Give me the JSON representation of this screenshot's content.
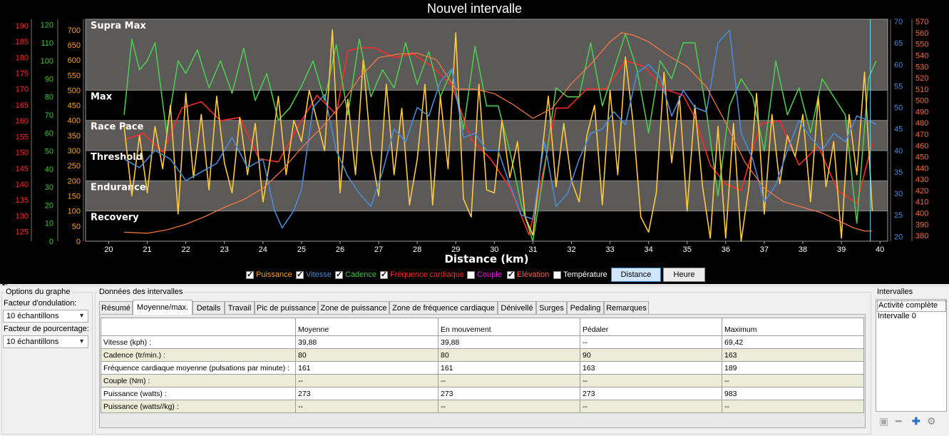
{
  "window": {
    "title": "Nouvel intervalle"
  },
  "chart_data": {
    "type": "line",
    "title": "Nouvel intervalle",
    "xlabel": "Distance (km)",
    "x_ticks": [
      20,
      21,
      22,
      23,
      24,
      25,
      26,
      27,
      28,
      29,
      30,
      31,
      32,
      33,
      34,
      35,
      36,
      37,
      38,
      39,
      40
    ],
    "xlim": [
      19.4,
      40.2
    ],
    "zones": [
      {
        "name": "Supra Max",
        "lo": 500,
        "hi": 735
      },
      {
        "name": "Max",
        "lo": 400,
        "hi": 500
      },
      {
        "name": "Race Pace",
        "lo": 300,
        "hi": 400
      },
      {
        "name": "Threshold",
        "lo": 200,
        "hi": 300
      },
      {
        "name": "Endurance",
        "lo": 100,
        "hi": 200
      },
      {
        "name": "Recovery",
        "lo": 0,
        "hi": 100
      }
    ],
    "axes": {
      "hr": {
        "label_color": "#ff2a2a",
        "min": 122,
        "max": 192,
        "ticks": [
          125,
          130,
          135,
          140,
          145,
          150,
          155,
          160,
          165,
          170,
          175,
          180,
          185,
          190
        ]
      },
      "cadence": {
        "label_color": "#3cc83c",
        "min": 0,
        "max": 123,
        "ticks": [
          0,
          10,
          20,
          30,
          40,
          50,
          60,
          70,
          80,
          90,
          100,
          110,
          120
        ]
      },
      "power": {
        "label_color": "#ffa020",
        "min": 0,
        "max": 735,
        "ticks": [
          0,
          50,
          100,
          150,
          200,
          250,
          300,
          350,
          400,
          450,
          500,
          550,
          600,
          650,
          700
        ]
      },
      "speed": {
        "label_color": "#4a8ad8",
        "min": 18.9,
        "max": 70.5,
        "ticks": [
          20,
          25,
          30,
          35,
          40,
          45,
          50,
          55,
          60,
          65,
          70
        ]
      },
      "elevation": {
        "label_color": "#ff6a3a",
        "min": 375,
        "max": 572,
        "ticks": [
          380,
          390,
          400,
          410,
          420,
          430,
          440,
          450,
          460,
          470,
          480,
          490,
          500,
          510,
          520,
          530,
          540,
          550,
          560,
          570
        ]
      }
    },
    "series": [
      {
        "name": "Fréquence cardiaque",
        "axis": "hr",
        "color": "#ff2a2a",
        "x": [
          20.4,
          20.9,
          21.4,
          21.9,
          22.4,
          22.9,
          23.4,
          23.9,
          24.4,
          24.9,
          25.4,
          25.9,
          26.2,
          26.5,
          26.9,
          27.4,
          27.9,
          28.4,
          28.9,
          29.4,
          29.9,
          30.4,
          30.9,
          31.2,
          31.6,
          31.9,
          32.4,
          32.9,
          33.4,
          33.9,
          34.4,
          34.9,
          35.2,
          35.6,
          36.0,
          36.4,
          36.9,
          37.4,
          37.9,
          38.4,
          38.9,
          39.4,
          39.8
        ],
        "values": [
          154,
          156,
          150,
          164,
          166,
          160,
          161,
          148,
          147,
          158,
          168,
          162,
          182,
          183,
          183,
          180,
          181,
          177,
          171,
          154,
          148,
          139,
          124,
          140,
          164,
          164,
          170,
          170,
          179,
          177,
          170,
          168,
          161,
          146,
          140,
          138,
          159,
          160,
          146,
          152,
          138,
          134,
          153
        ]
      },
      {
        "name": "Cadence",
        "axis": "cadence",
        "color": "#4fc84f",
        "x": [
          20.4,
          20.6,
          20.8,
          21.0,
          21.2,
          21.5,
          21.8,
          22.0,
          22.3,
          22.6,
          22.9,
          23.2,
          23.5,
          23.8,
          24.1,
          24.4,
          24.7,
          25.0,
          25.3,
          25.6,
          25.9,
          26.2,
          26.5,
          26.8,
          27.1,
          27.4,
          27.7,
          28.0,
          28.3,
          28.6,
          28.9,
          29.2,
          29.5,
          29.8,
          30.1,
          30.4,
          30.7,
          31.0,
          31.3,
          31.6,
          31.9,
          32.2,
          32.5,
          32.8,
          33.1,
          33.4,
          33.7,
          34.0,
          34.3,
          34.6,
          34.9,
          35.2,
          35.5,
          35.8,
          36.1,
          36.4,
          36.7,
          37.0,
          37.3,
          37.6,
          37.9,
          38.2,
          38.5,
          38.8,
          39.1,
          39.4,
          39.7,
          39.9
        ],
        "values": [
          70,
          112,
          95,
          100,
          110,
          60,
          100,
          93,
          106,
          85,
          100,
          82,
          107,
          78,
          93,
          67,
          74,
          86,
          100,
          78,
          109,
          70,
          112,
          80,
          95,
          85,
          110,
          87,
          105,
          80,
          95,
          62,
          108,
          75,
          75,
          50,
          20,
          0,
          40,
          85,
          80,
          80,
          110,
          75,
          95,
          115,
          95,
          60,
          100,
          90,
          110,
          110,
          72,
          25,
          75,
          90,
          80,
          50,
          100,
          70,
          85,
          60,
          90,
          80,
          70,
          10,
          90,
          100
        ]
      },
      {
        "name": "Puissance",
        "axis": "power",
        "color": "#ffca40",
        "x": [
          20.4,
          20.6,
          20.8,
          21.0,
          21.2,
          21.4,
          21.6,
          21.8,
          22.0,
          22.2,
          22.4,
          22.6,
          22.8,
          23.0,
          23.2,
          23.4,
          23.6,
          23.8,
          24.0,
          24.2,
          24.4,
          24.6,
          24.8,
          25.0,
          25.2,
          25.4,
          25.6,
          25.8,
          26.0,
          26.2,
          26.4,
          26.6,
          26.8,
          27.0,
          27.2,
          27.4,
          27.6,
          27.8,
          28.0,
          28.2,
          28.4,
          28.6,
          28.8,
          29.0,
          29.2,
          29.4,
          29.6,
          29.8,
          30.0,
          30.2,
          30.4,
          30.6,
          30.8,
          31.0,
          31.2,
          31.4,
          31.6,
          31.8,
          32.0,
          32.2,
          32.4,
          32.6,
          32.8,
          33.0,
          33.2,
          33.4,
          33.6,
          33.8,
          34.0,
          34.2,
          34.4,
          34.6,
          34.8,
          35.0,
          35.2,
          35.4,
          35.6,
          35.8,
          36.0,
          36.2,
          36.4,
          36.6,
          36.8,
          37.0,
          37.2,
          37.4,
          37.6,
          37.8,
          38.0,
          38.2,
          38.4,
          38.6,
          38.8,
          39.0,
          39.2,
          39.4,
          39.6,
          39.8
        ],
        "values": [
          380,
          150,
          350,
          160,
          380,
          240,
          450,
          90,
          490,
          210,
          420,
          170,
          480,
          260,
          160,
          410,
          220,
          390,
          130,
          280,
          480,
          220,
          400,
          330,
          500,
          400,
          300,
          700,
          160,
          470,
          220,
          600,
          300,
          150,
          520,
          220,
          440,
          120,
          270,
          520,
          120,
          480,
          240,
          690,
          140,
          80,
          520,
          170,
          160,
          400,
          210,
          330,
          80,
          20,
          250,
          480,
          180,
          390,
          200,
          130,
          350,
          450,
          120,
          500,
          220,
          610,
          390,
          80,
          30,
          160,
          560,
          260,
          480,
          100,
          450,
          180,
          10,
          380,
          10,
          390,
          0,
          180,
          490,
          90,
          420,
          190,
          350,
          280,
          420,
          130,
          480,
          180,
          330,
          10,
          420,
          220,
          560,
          100
        ]
      },
      {
        "name": "Vitesse",
        "axis": "speed",
        "color": "#4a8ad8",
        "x": [
          20.4,
          20.8,
          21.2,
          21.6,
          22.0,
          22.4,
          22.8,
          23.2,
          23.6,
          24.0,
          24.3,
          24.5,
          24.8,
          25.0,
          25.3,
          25.6,
          25.9,
          26.2,
          26.5,
          26.8,
          27.1,
          27.4,
          27.7,
          28.0,
          28.3,
          28.6,
          28.9,
          29.2,
          29.5,
          29.8,
          30.1,
          30.4,
          30.7,
          31.0,
          31.3,
          31.6,
          31.9,
          32.2,
          32.5,
          32.8,
          33.1,
          33.4,
          33.7,
          34.0,
          34.3,
          34.6,
          34.9,
          35.2,
          35.5,
          35.8,
          36.1,
          36.4,
          36.7,
          37.0,
          37.3,
          37.6,
          37.9,
          38.2,
          38.5,
          38.8,
          39.1,
          39.4,
          39.7,
          39.9
        ],
        "values": [
          38,
          36,
          40,
          38,
          33,
          35,
          37,
          43,
          36,
          38,
          26,
          22,
          26,
          31,
          50,
          53,
          40,
          34,
          30,
          27,
          35,
          45,
          42,
          50,
          48,
          56,
          59,
          43,
          44,
          40,
          40,
          32,
          25,
          24,
          42,
          27,
          30,
          38,
          44,
          45,
          49,
          46,
          58,
          60,
          57,
          48,
          54,
          50,
          49,
          65,
          68,
          44,
          38,
          28,
          32,
          40,
          47,
          43,
          40,
          44,
          42,
          48,
          47,
          46
        ]
      },
      {
        "name": "Elévation",
        "axis": "elevation",
        "color": "#ff7a40",
        "x": [
          20.4,
          21.0,
          21.5,
          22.0,
          22.5,
          23.0,
          23.5,
          24.0,
          24.5,
          25.0,
          25.5,
          26.0,
          26.5,
          27.0,
          27.5,
          28.0,
          28.5,
          29.0,
          29.5,
          30.0,
          30.5,
          31.0,
          31.5,
          32.0,
          32.5,
          33.0,
          33.3,
          33.6,
          34.0,
          34.5,
          35.0,
          35.5,
          36.0,
          36.5,
          37.0,
          37.5,
          38.0,
          38.5,
          39.0,
          39.3,
          39.6,
          39.8
        ],
        "values": [
          383,
          382,
          385,
          390,
          397,
          405,
          412,
          422,
          438,
          458,
          475,
          495,
          520,
          538,
          541,
          542,
          536,
          510,
          510,
          506,
          496,
          484,
          493,
          515,
          532,
          552,
          560,
          558,
          552,
          540,
          530,
          512,
          480,
          445,
          422,
          410,
          405,
          400,
          392,
          387,
          384,
          384
        ]
      }
    ],
    "cursor_x": 39.75
  },
  "legend": {
    "items": [
      {
        "label": "Puissance",
        "checked": true,
        "color": "#ffa020"
      },
      {
        "label": "Vitesse",
        "checked": true,
        "color": "#4a8ad8"
      },
      {
        "label": "Cadence",
        "checked": true,
        "color": "#3cc83c"
      },
      {
        "label": "Fréquence cardiaque",
        "checked": true,
        "color": "#ff2a2a"
      },
      {
        "label": "Couple",
        "checked": false,
        "color": "#e020e0"
      },
      {
        "label": "Elévation",
        "checked": true,
        "color": "#ff6a3a"
      },
      {
        "label": "Température",
        "checked": false,
        "color": "#ffffff"
      }
    ],
    "buttons": {
      "distance": "Distance",
      "heure": "Heure"
    }
  },
  "options": {
    "title": "Options du graphe",
    "smoothing_label": "Facteur d'ondulation:",
    "smoothing_value": "10 échantillons",
    "percent_label": "Facteur de pourcentage:",
    "percent_value": "10 échantillons"
  },
  "interval_data": {
    "title": "Données des intervalles",
    "tabs": [
      "Résumé",
      "Moyenne/max.",
      "Details",
      "Travail",
      "Pic de puissance",
      "Zone de puissance",
      "Zone de fréquence cardiaque",
      "Dénivellé",
      "Surges",
      "Pedaling",
      "Remarques"
    ],
    "active_tab": 1,
    "table": {
      "headers": [
        "",
        "Moyenne",
        "En mouvement",
        "Pédaler",
        "Maximum"
      ],
      "rows": [
        [
          "Vitesse (kph) :",
          "39,88",
          "39,88",
          "--",
          "69,42"
        ],
        [
          "Cadence (tr/min.) :",
          "80",
          "80",
          "90",
          "163"
        ],
        [
          "Fréquence cardiaque moyenne (pulsations par minute) :",
          "161",
          "161",
          "163",
          "189"
        ],
        [
          "Couple (Nm) :",
          "--",
          "--",
          "--",
          "--"
        ],
        [
          "Puissance (watts) :",
          "273",
          "273",
          "273",
          "983"
        ],
        [
          "Puissance (watts//kg) :",
          "--",
          "--",
          "--",
          "--"
        ]
      ]
    }
  },
  "intervals": {
    "title": "Intervalles",
    "items": [
      "Activité complète",
      "Intervalle 0"
    ]
  }
}
